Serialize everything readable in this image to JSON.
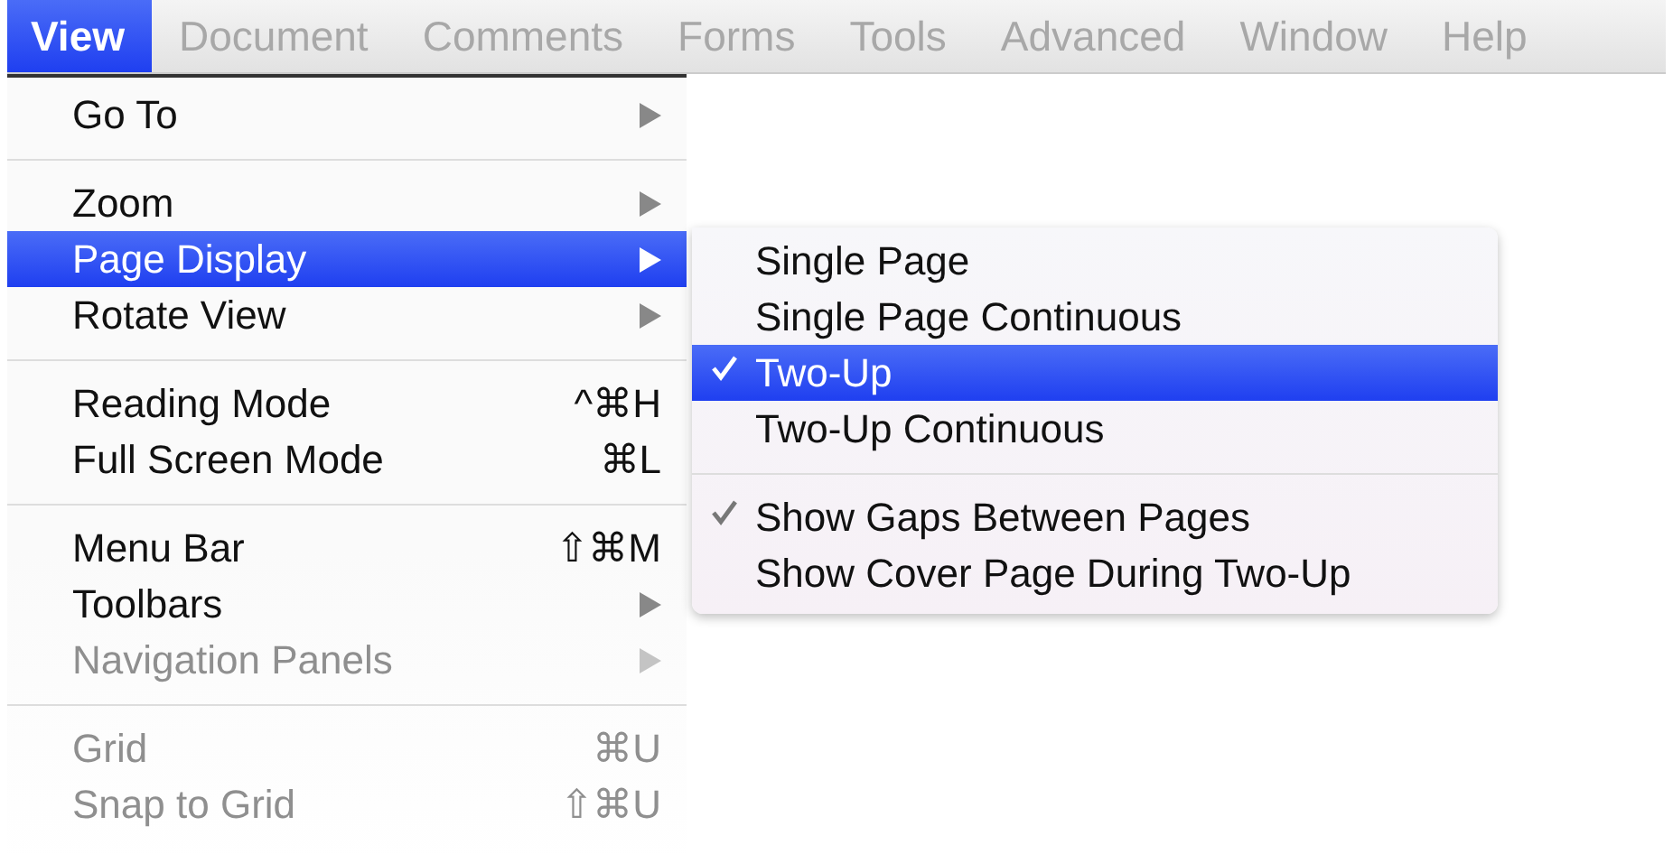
{
  "menu_bar": [
    {
      "label": "View",
      "selected": true
    },
    {
      "label": "Document",
      "selected": false
    },
    {
      "label": "Comments",
      "selected": false
    },
    {
      "label": "Forms",
      "selected": false
    },
    {
      "label": "Tools",
      "selected": false
    },
    {
      "label": "Advanced",
      "selected": false
    },
    {
      "label": "Window",
      "selected": false
    },
    {
      "label": "Help",
      "selected": false
    }
  ],
  "view_menu": [
    {
      "kind": "item",
      "label": "Go To",
      "submenu": true,
      "selected": false,
      "disabled": false
    },
    {
      "kind": "separator"
    },
    {
      "kind": "item",
      "label": "Zoom",
      "submenu": true,
      "selected": false,
      "disabled": false
    },
    {
      "kind": "item",
      "label": "Page Display",
      "submenu": true,
      "selected": true,
      "disabled": false
    },
    {
      "kind": "item",
      "label": "Rotate View",
      "submenu": true,
      "selected": false,
      "disabled": false
    },
    {
      "kind": "separator"
    },
    {
      "kind": "item",
      "label": "Reading Mode",
      "shortcut": "^⌘H",
      "selected": false,
      "disabled": false
    },
    {
      "kind": "item",
      "label": "Full Screen Mode",
      "shortcut": "⌘L",
      "selected": false,
      "disabled": false
    },
    {
      "kind": "separator"
    },
    {
      "kind": "item",
      "label": "Menu Bar",
      "shortcut": "⇧⌘M",
      "selected": false,
      "disabled": false
    },
    {
      "kind": "item",
      "label": "Toolbars",
      "submenu": true,
      "selected": false,
      "disabled": false
    },
    {
      "kind": "item",
      "label": "Navigation Panels",
      "submenu": true,
      "selected": false,
      "disabled": true
    },
    {
      "kind": "separator"
    },
    {
      "kind": "item",
      "label": "Grid",
      "shortcut": "⌘U",
      "selected": false,
      "disabled": true
    },
    {
      "kind": "item",
      "label": "Snap to Grid",
      "shortcut": "⇧⌘U",
      "selected": false,
      "disabled": true
    }
  ],
  "page_display_submenu": [
    {
      "kind": "item",
      "label": "Single Page",
      "checked": false,
      "selected": false
    },
    {
      "kind": "item",
      "label": "Single Page Continuous",
      "checked": false,
      "selected": false
    },
    {
      "kind": "item",
      "label": "Two-Up",
      "checked": true,
      "selected": true
    },
    {
      "kind": "item",
      "label": "Two-Up Continuous",
      "checked": false,
      "selected": false
    },
    {
      "kind": "separator"
    },
    {
      "kind": "item",
      "label": "Show Gaps Between Pages",
      "checked": true,
      "selected": false
    },
    {
      "kind": "item",
      "label": "Show Cover Page During Two-Up",
      "checked": false,
      "selected": false
    }
  ]
}
